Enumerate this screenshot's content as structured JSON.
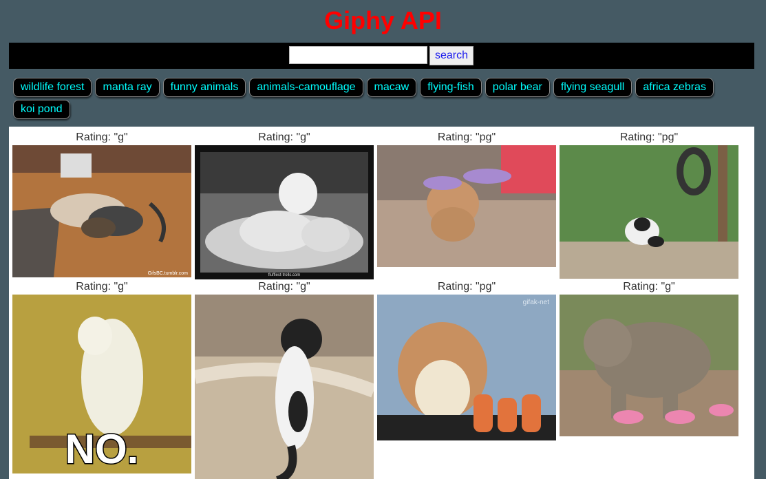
{
  "header": {
    "title": "Giphy API"
  },
  "search": {
    "value": "",
    "placeholder": "",
    "button_label": "search"
  },
  "topics": [
    "wildlife forest",
    "manta ray",
    "funny animals",
    "animals-camouflage",
    "macaw",
    "flying-fish",
    "polar bear",
    "flying seagull",
    "africa zebras",
    "koi pond"
  ],
  "results": [
    {
      "rating": "Rating: \"g\"",
      "image_label": "dog-and-boy-gif",
      "caption": "GifsBC.tumblr.com"
    },
    {
      "rating": "Rating: \"g\"",
      "image_label": "cat-massage-gif",
      "caption": "fluffiest-trolls.com"
    },
    {
      "rating": "Rating: \"pg\"",
      "image_label": "puppy-with-wings-gif",
      "caption": ""
    },
    {
      "rating": "Rating: \"pg\"",
      "image_label": "panda-rolling-gif",
      "caption": ""
    },
    {
      "rating": "Rating: \"g\"",
      "image_label": "cockatoo-no-gif",
      "caption": "NO."
    },
    {
      "rating": "Rating: \"g\"",
      "image_label": "cat-standing-gif",
      "caption": ""
    },
    {
      "rating": "Rating: \"pg\"",
      "image_label": "hamster-eating-carrot-gif",
      "caption": "gifak-net"
    },
    {
      "rating": "Rating: \"g\"",
      "image_label": "elephant-in-sneakers-gif",
      "caption": ""
    }
  ],
  "colors": {
    "page_bg": "#455a64",
    "title": "#ff0000",
    "topic_text": "#00ffff",
    "topic_bg": "#000000",
    "results_bg": "#ffffff"
  }
}
